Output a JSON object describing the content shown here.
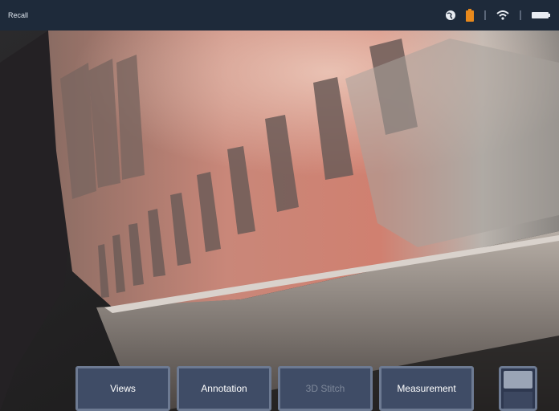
{
  "status_bar": {
    "title": "Recall",
    "icons": [
      "globe-icon",
      "battery-charging-icon",
      "wifi-icon",
      "battery-icon"
    ],
    "colors": {
      "background": "#1e2a3a",
      "battery_charging": "#e8891c"
    }
  },
  "viewport": {
    "description_icon": "camera-live-view"
  },
  "toolbar": {
    "buttons": [
      {
        "label": "Views",
        "enabled": true
      },
      {
        "label": "Annotation",
        "enabled": true
      },
      {
        "label": "3D Stitch",
        "enabled": false
      },
      {
        "label": "Measurement",
        "enabled": true
      }
    ],
    "colors": {
      "button_bg": "#3f4c66",
      "button_border": "#6d7a92",
      "disabled_text": "#7e889a"
    }
  },
  "screen_toggle": {
    "icon": "split-screen-icon"
  }
}
